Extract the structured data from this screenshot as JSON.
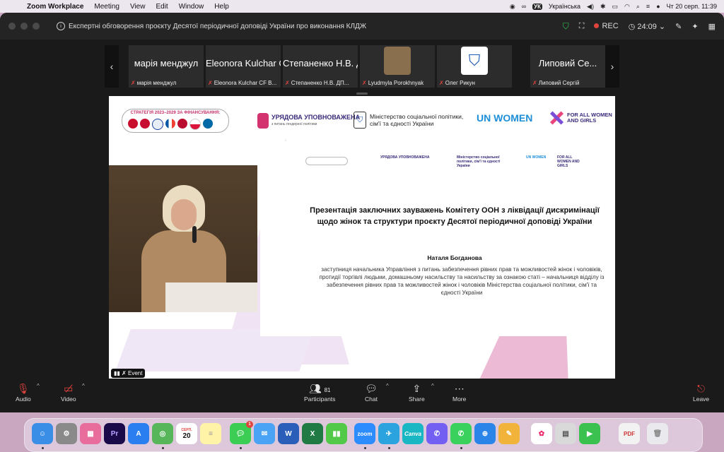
{
  "menubar": {
    "apple": "",
    "items": [
      "Zoom Workplace",
      "Meeting",
      "View",
      "Edit",
      "Window",
      "Help"
    ],
    "right": {
      "keyboard": "Українська",
      "vk_badge": "УК",
      "datetime": "Чт 20 серп.  11:39"
    }
  },
  "window": {
    "title": "Експертні обговорення проєкту Десятої періодичної доповіді України про виконання КЛДЖ",
    "rec_label": "REC",
    "timer": "24:09"
  },
  "participants_strip": [
    {
      "big": "марія менджул",
      "label": "марія менджул"
    },
    {
      "big": "Eleonora Kulchar CF B...",
      "label": "Eleonora Kulchar CF B..."
    },
    {
      "big": "Степаненко Н.В. ДП...",
      "label": "Степаненко Н.В. ДП..."
    },
    {
      "big": "",
      "label": "Lyudmyla Porokhnyak"
    },
    {
      "big": "",
      "label": "Олег Рикун"
    },
    {
      "big": "Липовий Се...",
      "label": "Липовий Сергій"
    }
  ],
  "share": {
    "strategy_caption": "СТРАТЕГІЯ 2023–2029 ЗА ФІНАНСУВАННЯ:",
    "uv_title": "УРЯДОВА УПОВНОВАЖЕНА",
    "uv_sub": "з питань гендерної політики",
    "ministry": "Міністерство соціальної політики, сім'ї та єдності України",
    "unwomen": "UN WOMEN",
    "forall": "FOR ALL WOMEN AND GIRLS",
    "heading": "Презентація заключних зауважень Комітету ООН з ліквідації дискримінації щодо жінок та структури проєкту Десятої періодичної доповіді України",
    "speaker": "Наталя Богданова",
    "description": "заступниця начальника Управління з питань забезпечення рівних прав та можливостей жінок і чоловіків, протидії торгівлі людьми, домашньому насильству та насильству за ознакою статі – начальниця відділу із забезпечення рівних прав та можливостей жінок і чоловіків Міністерства соціальної політики, сім'ї та єдності України",
    "event_tag": "Event"
  },
  "toolbar": {
    "audio": "Audio",
    "video": "Video",
    "participants": "Participants",
    "participants_count": "81",
    "chat": "Chat",
    "share": "Share",
    "more": "More",
    "leave": "Leave"
  },
  "dock": {
    "calendar_month": "СЕРП.",
    "calendar_day": "20",
    "messages_badge": "1",
    "zoom_label": "zoom",
    "canva_label": "Canva",
    "premiere_label": "Pr"
  }
}
